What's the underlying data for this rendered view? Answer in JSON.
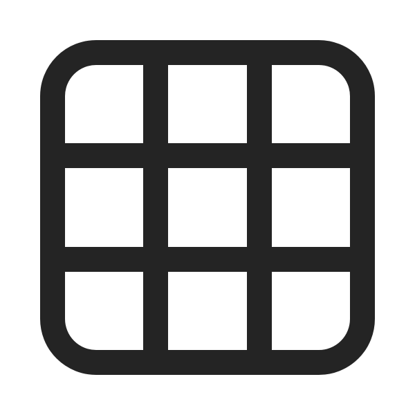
{
  "icon": {
    "name": "grid-icon",
    "color": "#242424",
    "background": "#ffffff",
    "rows": 3,
    "columns": 3
  }
}
